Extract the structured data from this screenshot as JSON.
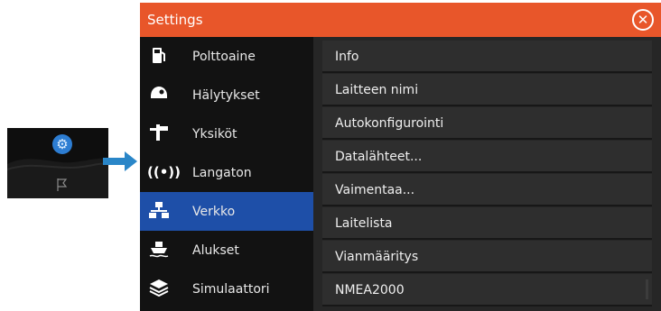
{
  "window": {
    "title": "Settings"
  },
  "left_menu": [
    {
      "label": "Polttoaine",
      "icon": "fuel-pump-icon"
    },
    {
      "label": "Hälytykset",
      "icon": "alarm-bell-icon"
    },
    {
      "label": "Yksiköt",
      "icon": "units-icon"
    },
    {
      "label": "Langaton",
      "icon": "wireless-icon"
    },
    {
      "label": "Verkko",
      "icon": "network-icon",
      "selected": true
    },
    {
      "label": "Alukset",
      "icon": "vessel-icon"
    },
    {
      "label": "Simulaattori",
      "icon": "simulator-icon"
    }
  ],
  "right_menu": [
    {
      "label": "Info"
    },
    {
      "label": "Laitteen nimi"
    },
    {
      "label": "Autokonfigurointi"
    },
    {
      "label": "Datalähteet..."
    },
    {
      "label": "Vaimentaa..."
    },
    {
      "label": "Laitelista"
    },
    {
      "label": "Vianmääritys"
    },
    {
      "label": "NMEA2000"
    }
  ],
  "colors": {
    "title_bar": "#e8562a",
    "selected": "#1e4fa8",
    "thumb_gear": "#2d7dd2",
    "arrow": "#2a86c8"
  }
}
